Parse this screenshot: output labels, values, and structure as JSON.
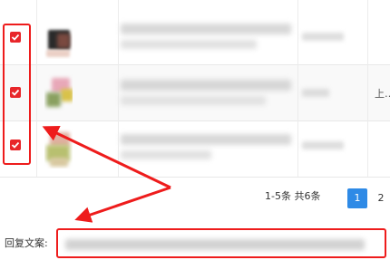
{
  "rows": [
    {
      "checked": true,
      "thumb_colors": [
        "#2a2a2a",
        "#7a4a40",
        "#ebd0c6"
      ],
      "status_text": ""
    },
    {
      "checked": true,
      "thumb_colors": [
        "#e8a8b8",
        "#d9c24a",
        "#8aa060"
      ],
      "status_text": "上…"
    },
    {
      "checked": true,
      "thumb_colors": [
        "#e0b0a0",
        "#b8c070",
        "#d8c8a0"
      ],
      "status_text": ""
    }
  ],
  "pagination": {
    "summary": "1-5条 共6条",
    "current_page": "1",
    "next_page": "2"
  },
  "reply": {
    "label": "回复文案:"
  },
  "colors": {
    "highlight": "#ee1c1c",
    "checkbox": "#e8262a",
    "page_active": "#2e8ae6"
  }
}
